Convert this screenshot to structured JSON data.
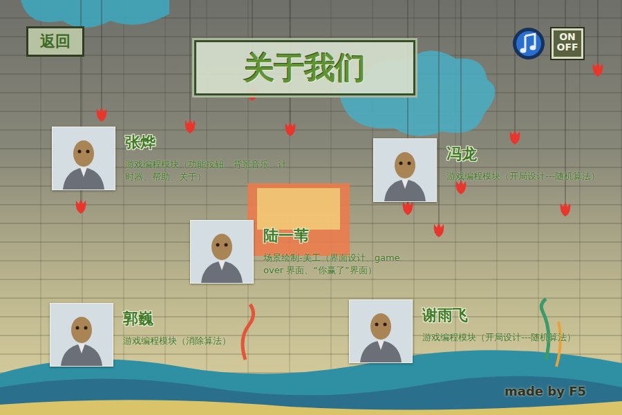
{
  "back_button": "返回",
  "title": "关于我们",
  "music": {
    "label_on": "ON",
    "label_off": "OFF"
  },
  "members": [
    {
      "name": "张烨",
      "role": "游戏编程模块（功能按钮、背景音乐、计时器、帮助、关于）"
    },
    {
      "name": "冯龙",
      "role": "游戏编程模块（开局设计---随机算法）"
    },
    {
      "name": "陆一苇",
      "role": "场景绘制-美工（界面设计、game over 界面、“你赢了”界面）"
    },
    {
      "name": "郭巍",
      "role": "游戏编程模块（消除算法）"
    },
    {
      "name": "谢雨飞",
      "role": "游戏编程模块（开局设计---随机算法）"
    }
  ],
  "footer": "made by F5"
}
